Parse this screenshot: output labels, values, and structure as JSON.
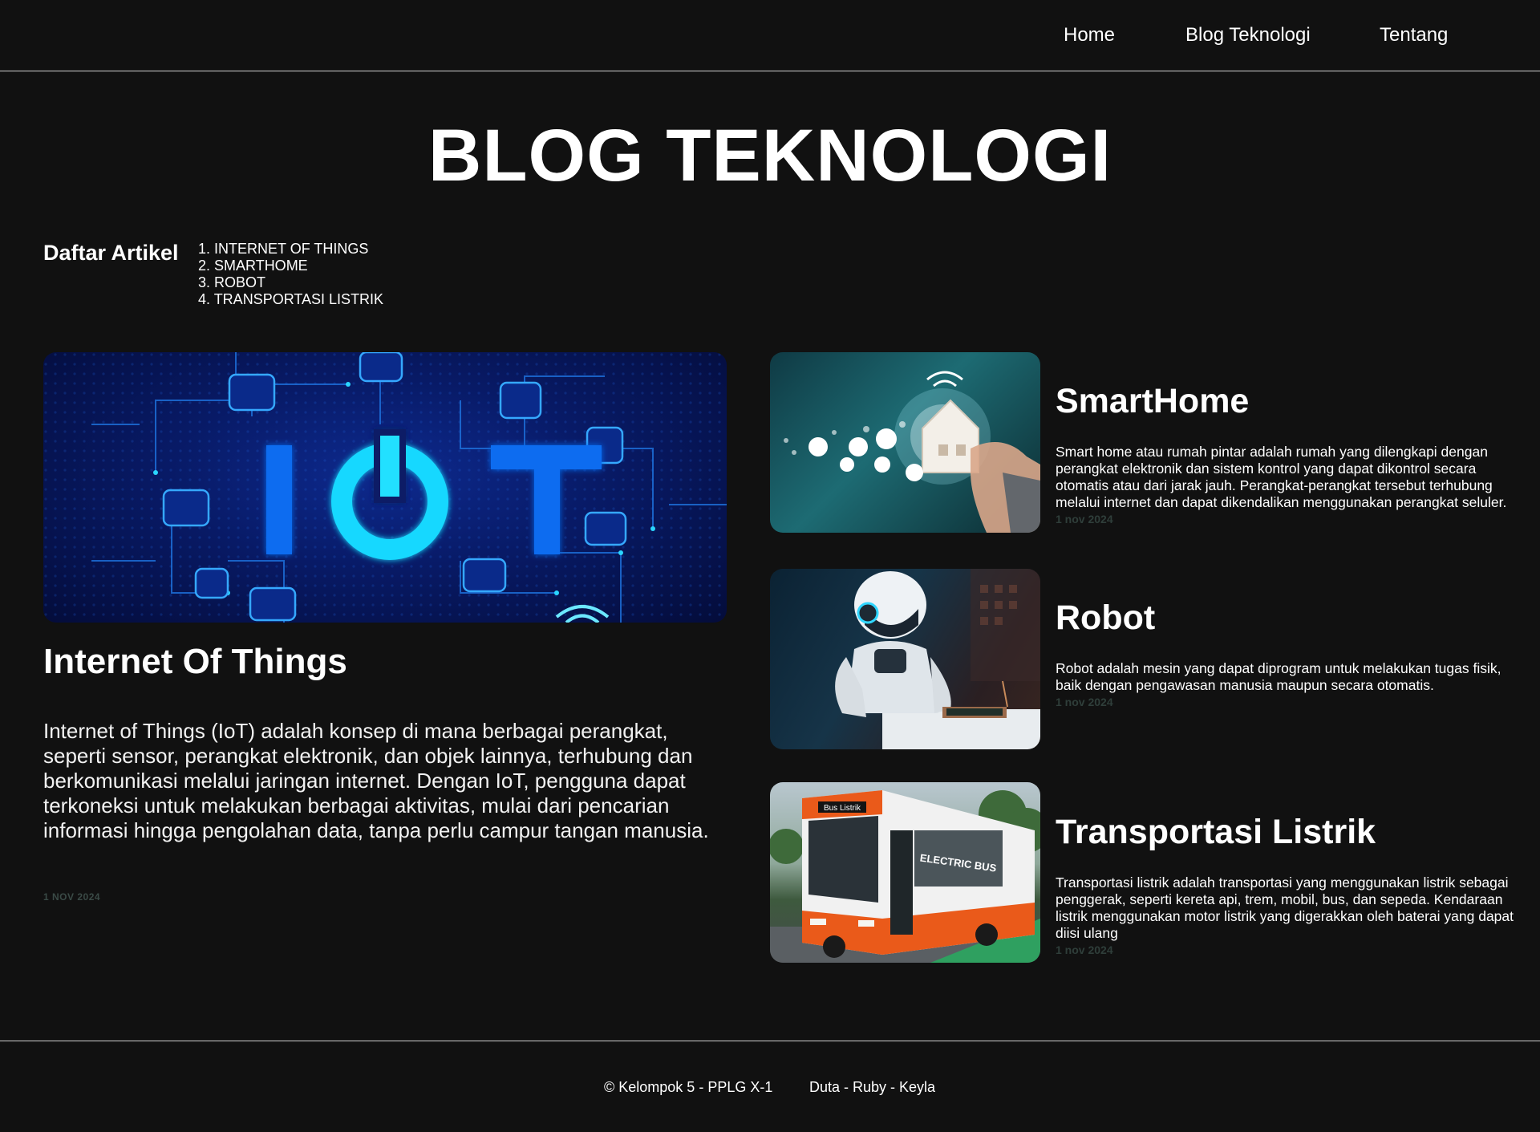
{
  "nav": {
    "home": "Home",
    "blog": "Blog Teknologi",
    "about": "Tentang"
  },
  "page_title": "BLOG TEKNOLOGI",
  "toc": {
    "label": "Daftar Artikel",
    "items": [
      "1. INTERNET OF THINGS",
      "2. SMARTHOME",
      "3. ROBOT",
      "4. TRANSPORTASI LISTRIK"
    ]
  },
  "featured": {
    "image_text": "IOT",
    "title": "Internet Of Things",
    "description": "Internet of Things (IoT) adalah konsep di mana berbagai perangkat, seperti sensor, perangkat elektronik, dan objek lainnya, terhubung dan berkomunikasi melalui jaringan internet. Dengan IoT, pengguna dapat terkoneksi untuk melakukan berbagai aktivitas, mulai dari pencarian informasi hingga pengolahan data, tanpa perlu campur tangan manusia.",
    "date": "1 NOV 2024"
  },
  "articles": [
    {
      "title": "SmartHome",
      "description": "Smart home atau rumah pintar adalah rumah yang dilengkapi dengan perangkat elektronik dan sistem kontrol yang dapat dikontrol secara otomatis atau dari jarak jauh. Perangkat-perangkat tersebut terhubung melalui internet dan dapat dikendalikan menggunakan perangkat seluler.",
      "date": "1 nov 2024"
    },
    {
      "title": "Robot",
      "description": "Robot adalah mesin yang dapat diprogram untuk melakukan tugas fisik, baik dengan pengawasan manusia maupun secara otomatis.",
      "date": "1 nov 2024"
    },
    {
      "title": "Transportasi Listrik",
      "description": "Transportasi listrik adalah transportasi yang menggunakan listrik sebagai penggerak, seperti kereta api, trem, mobil, bus, dan sepeda. Kendaraan listrik menggunakan motor listrik yang digerakkan oleh baterai yang dapat diisi ulang",
      "date": "1 nov 2024",
      "image_texts": {
        "bus_sign": "Bus Listrik",
        "side_text": "ELECTRIC BUS"
      }
    }
  ],
  "footer": {
    "left": "© Kelompok 5 - PPLG X-1",
    "right": "Duta - Ruby - Keyla"
  },
  "colors": {
    "background": "#111111",
    "text": "#ffffff",
    "date": "#3a4a46",
    "iot_accent": "#00c8ff"
  }
}
